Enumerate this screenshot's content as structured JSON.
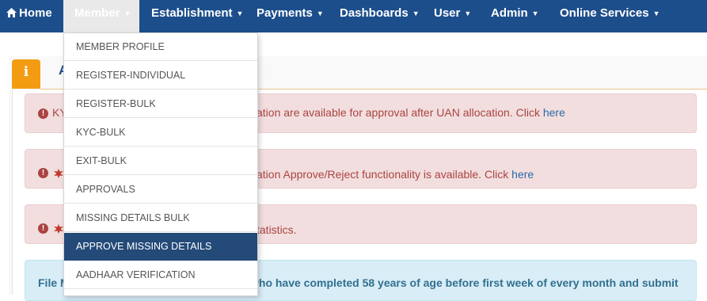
{
  "navbar": {
    "home": "Home",
    "member": "Member",
    "establishment": "Establishment",
    "payments": "Payments",
    "dashboards": "Dashboards",
    "user": "User",
    "admin": "Admin",
    "online_services": "Online Services"
  },
  "panel": {
    "info_glyph": "i",
    "title_partial": "A"
  },
  "alerts": [
    {
      "prefix": "KY",
      "text": "ation are available for approval after UAN allocation. Click ",
      "link": "here"
    },
    {
      "text": "ation Approve/Reject functionality is available. Click ",
      "link": "here"
    },
    {
      "text": "tatistics."
    }
  ],
  "info_bar": {
    "left": "File M",
    "right": "who have completed 58 years of age before first week of every month and submit"
  },
  "member_menu": {
    "items": [
      "MEMBER PROFILE",
      "REGISTER-INDIVIDUAL",
      "REGISTER-BULK",
      "KYC-BULK",
      "EXIT-BULK",
      "APPROVALS",
      "MISSING DETAILS BULK",
      "APPROVE MISSING DETAILS",
      "AADHAAR VERIFICATION"
    ],
    "selected": "APPROVE MISSING DETAILS"
  },
  "colors": {
    "navbar": "#1c4e8c",
    "selected_item": "#234a78",
    "alert_bg": "#f2dede",
    "info_bg": "#d9edf7",
    "info_tab": "#f39c12"
  }
}
